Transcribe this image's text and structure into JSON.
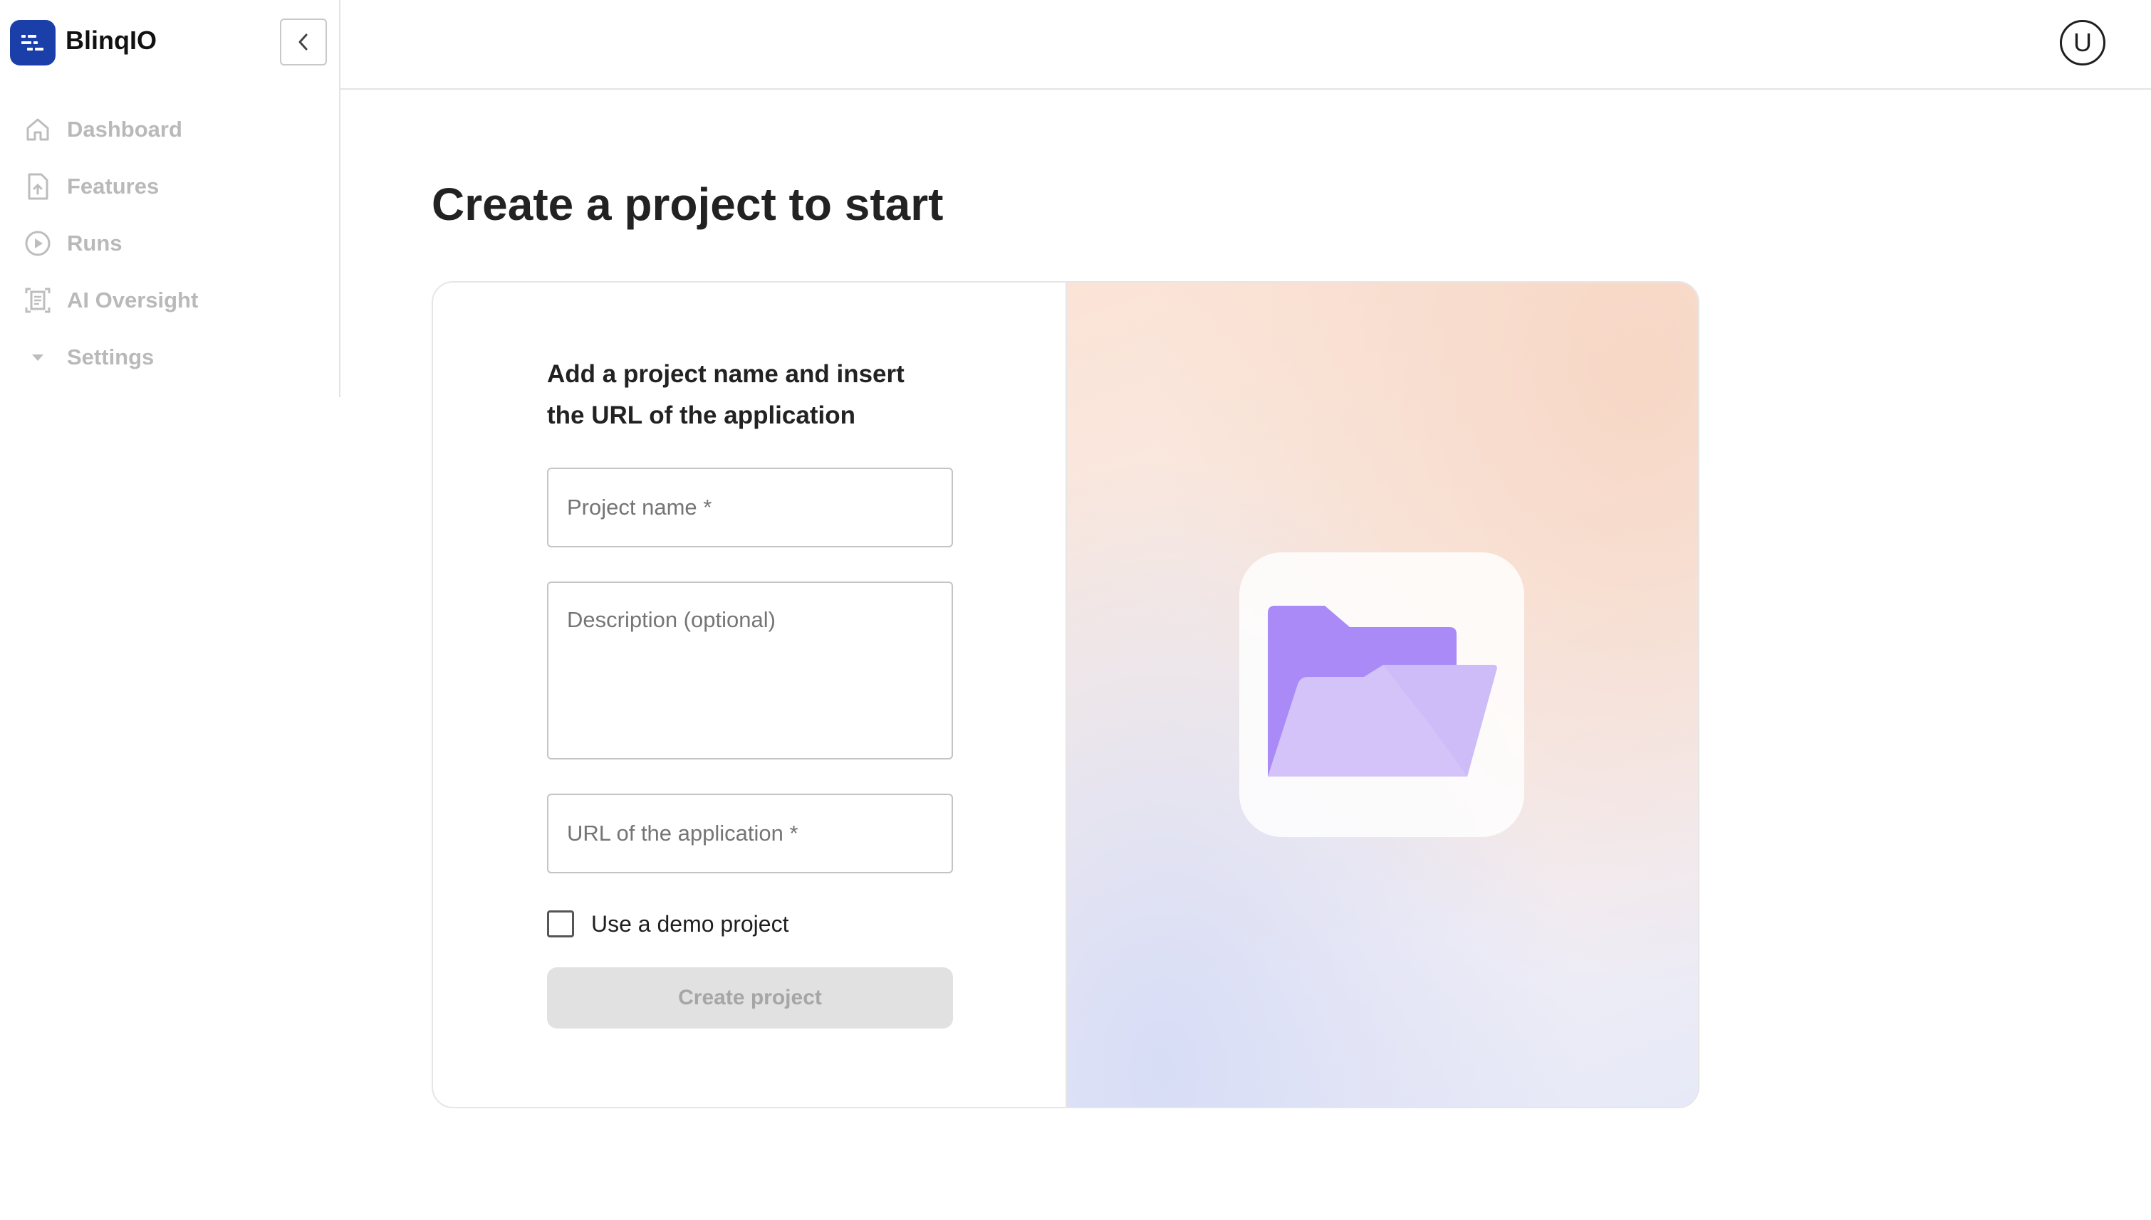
{
  "brand": {
    "name": "BlinqIO"
  },
  "sidebar": {
    "items": [
      {
        "label": "Dashboard",
        "icon": "home-icon"
      },
      {
        "label": "Features",
        "icon": "file-upload-icon"
      },
      {
        "label": "Runs",
        "icon": "play-circle-icon"
      },
      {
        "label": "AI Oversight",
        "icon": "document-scan-icon"
      },
      {
        "label": "Settings",
        "icon": "caret-down-icon"
      }
    ]
  },
  "header": {
    "avatar_initial": "U"
  },
  "main": {
    "title": "Create a project to start",
    "form": {
      "heading": "Add a project name and insert the URL of the application",
      "project_name_placeholder": "Project name *",
      "description_placeholder": "Description (optional)",
      "url_placeholder": "URL of the application *",
      "demo_label": "Use a demo project",
      "demo_checked": false,
      "submit_label": "Create project"
    },
    "illustration": {
      "icon": "folder-icon"
    }
  },
  "colors": {
    "brand": "#1a3fa8",
    "nav_text": "#b9b9b9",
    "folder_purple": "#a98af7",
    "button_disabled": "#e1e1e1"
  }
}
